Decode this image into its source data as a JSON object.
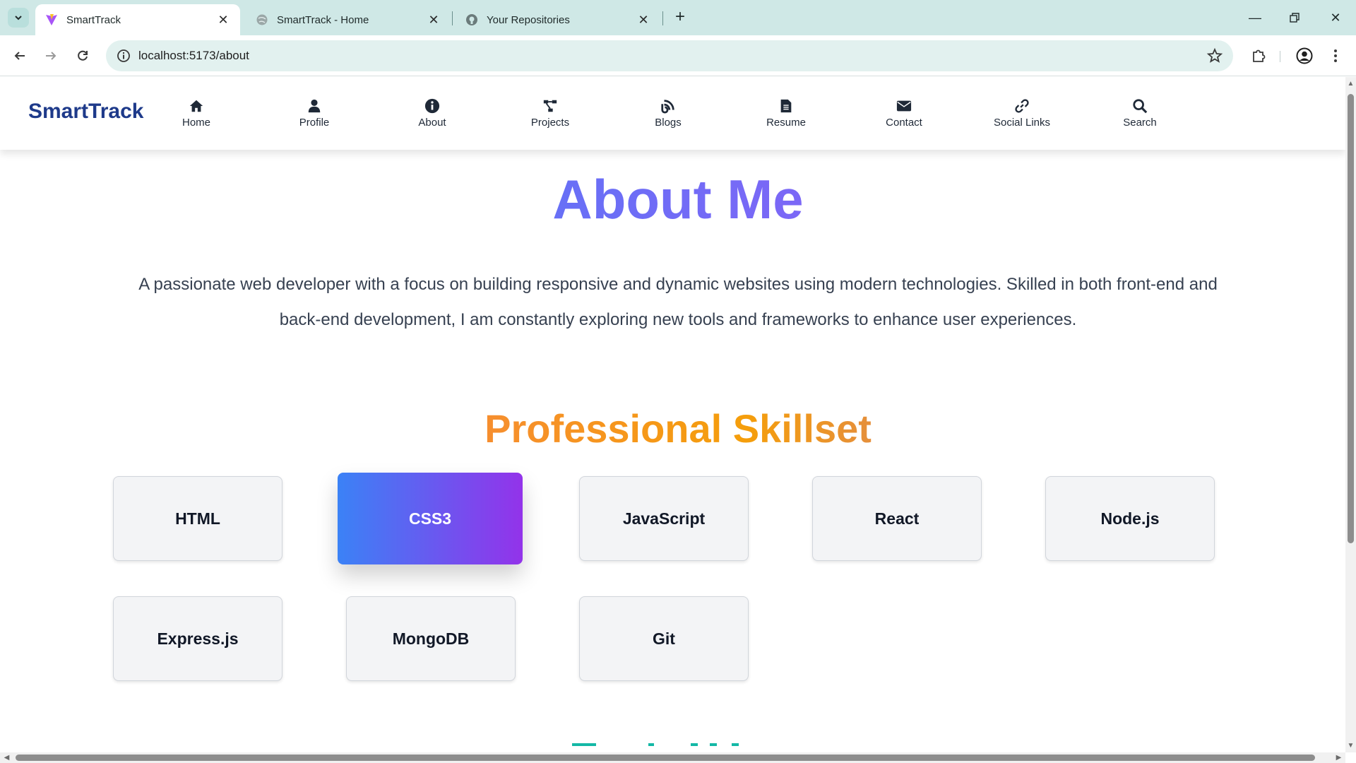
{
  "browser": {
    "tabs": [
      {
        "title": "SmartTrack",
        "active": true,
        "favicon": "vite-logo-icon"
      },
      {
        "title": "SmartTrack - Home",
        "active": false,
        "favicon": "globe-icon"
      },
      {
        "title": "Your Repositories",
        "active": false,
        "favicon": "github-icon"
      }
    ],
    "url": "localhost:5173/about"
  },
  "site": {
    "brand": "SmartTrack",
    "nav": [
      {
        "label": "Home",
        "icon": "home-icon"
      },
      {
        "label": "Profile",
        "icon": "user-icon"
      },
      {
        "label": "About",
        "icon": "info-circle-icon"
      },
      {
        "label": "Projects",
        "icon": "project-diagram-icon"
      },
      {
        "label": "Blogs",
        "icon": "blog-icon"
      },
      {
        "label": "Resume",
        "icon": "file-icon"
      },
      {
        "label": "Contact",
        "icon": "envelope-icon"
      },
      {
        "label": "Social Links",
        "icon": "link-icon"
      },
      {
        "label": "Search",
        "icon": "search-icon"
      }
    ]
  },
  "about": {
    "title": "About Me",
    "text": "A passionate web developer with a focus on building responsive and dynamic websites using modern technologies. Skilled in both front-end and back-end development, I am constantly exploring new tools and frameworks to enhance user experiences."
  },
  "skills": {
    "title": "Professional Skillset",
    "items": [
      "HTML",
      "CSS3",
      "JavaScript",
      "React",
      "Node.js",
      "Express.js",
      "MongoDB",
      "Git"
    ],
    "hovered": "CSS3"
  },
  "colors": {
    "brand": "#1e3a8a",
    "title_gradient": [
      "#3b82f6",
      "#a855f7"
    ],
    "skill_title_gradient": [
      "#f87171",
      "#f59e0b",
      "#a855f7"
    ],
    "chrome_tabbar": "#cfe8e6"
  }
}
